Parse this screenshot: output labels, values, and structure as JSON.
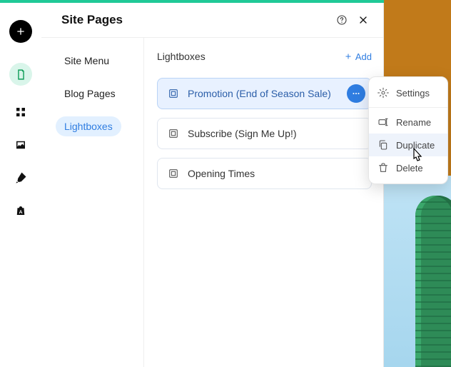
{
  "panel": {
    "title": "Site Pages"
  },
  "side": {
    "items": [
      {
        "label": "Site Menu"
      },
      {
        "label": "Blog Pages"
      },
      {
        "label": "Lightboxes"
      }
    ],
    "selectedIndex": 2
  },
  "content": {
    "heading": "Lightboxes",
    "addLabel": "Add",
    "items": [
      {
        "label": "Promotion (End of Season Sale)"
      },
      {
        "label": "Subscribe (Sign Me Up!)"
      },
      {
        "label": "Opening Times"
      }
    ],
    "activeIndex": 0
  },
  "contextMenu": {
    "items": [
      {
        "label": "Settings",
        "icon": "gear"
      },
      {
        "label": "Rename",
        "icon": "rename"
      },
      {
        "label": "Duplicate",
        "icon": "duplicate"
      },
      {
        "label": "Delete",
        "icon": "trash"
      }
    ],
    "dividerAfter": [
      0
    ],
    "hoveredIndex": 2
  },
  "colors": {
    "accent": "#2f7de1",
    "topbar": "#20c997"
  }
}
